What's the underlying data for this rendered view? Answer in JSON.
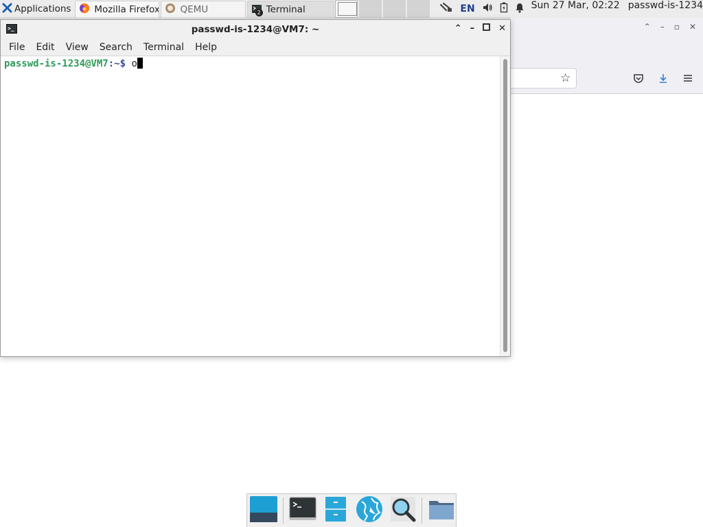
{
  "panel": {
    "applications_label": "Applications",
    "tasks": [
      {
        "label": "Mozilla Firefox",
        "icon": "firefox-icon"
      },
      {
        "label": "QEMU",
        "icon": "qemu-icon"
      },
      {
        "label": "Terminal",
        "icon": "terminal-icon",
        "badge": "2"
      }
    ],
    "language": "EN",
    "clock": "Sun 27 Mar, 02:22",
    "user": "passwd-is-1234"
  },
  "terminal": {
    "title": "passwd-is-1234@VM7: ~",
    "menu": [
      "File",
      "Edit",
      "View",
      "Search",
      "Terminal",
      "Help"
    ],
    "prompt_user": "passwd-is-1234@VM7",
    "prompt_path": ":~$",
    "input_text": "o"
  },
  "firefox": {
    "icons": [
      "bookmark-star-icon",
      "pocket-icon",
      "downloads-icon",
      "menu-icon"
    ]
  },
  "dock": {
    "items": [
      "show-desktop-icon",
      "terminal-icon",
      "file-manager-icon",
      "web-browser-icon",
      "app-finder-icon",
      "folder-icon"
    ]
  },
  "colors": {
    "prompt_user": "#2e9b5a",
    "prompt_path": "#3a4a9a",
    "accent": "#2aa7d8"
  }
}
